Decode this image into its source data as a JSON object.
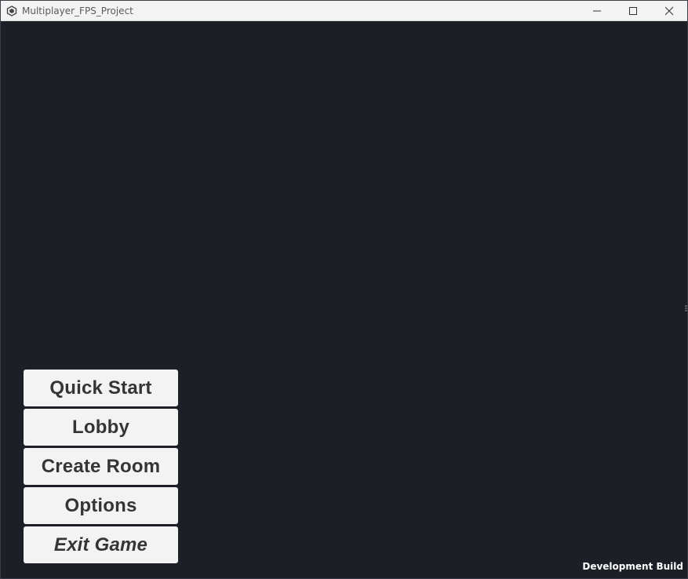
{
  "window": {
    "title": "Multiplayer_FPS_Project"
  },
  "icons": {
    "app": "unity-logo-icon",
    "minimize": "minimize-icon",
    "maximize": "maximize-icon",
    "close": "close-icon"
  },
  "menu": {
    "items": [
      {
        "label": "Quick Start"
      },
      {
        "label": "Lobby"
      },
      {
        "label": "Create Room"
      },
      {
        "label": "Options"
      },
      {
        "label": "Exit Game"
      }
    ]
  },
  "watermark": "Development Build",
  "colors": {
    "background": "#1d1f27",
    "button_bg": "#f3f3f3",
    "button_text": "#353535",
    "titlebar_bg": "#f3f3f3"
  }
}
